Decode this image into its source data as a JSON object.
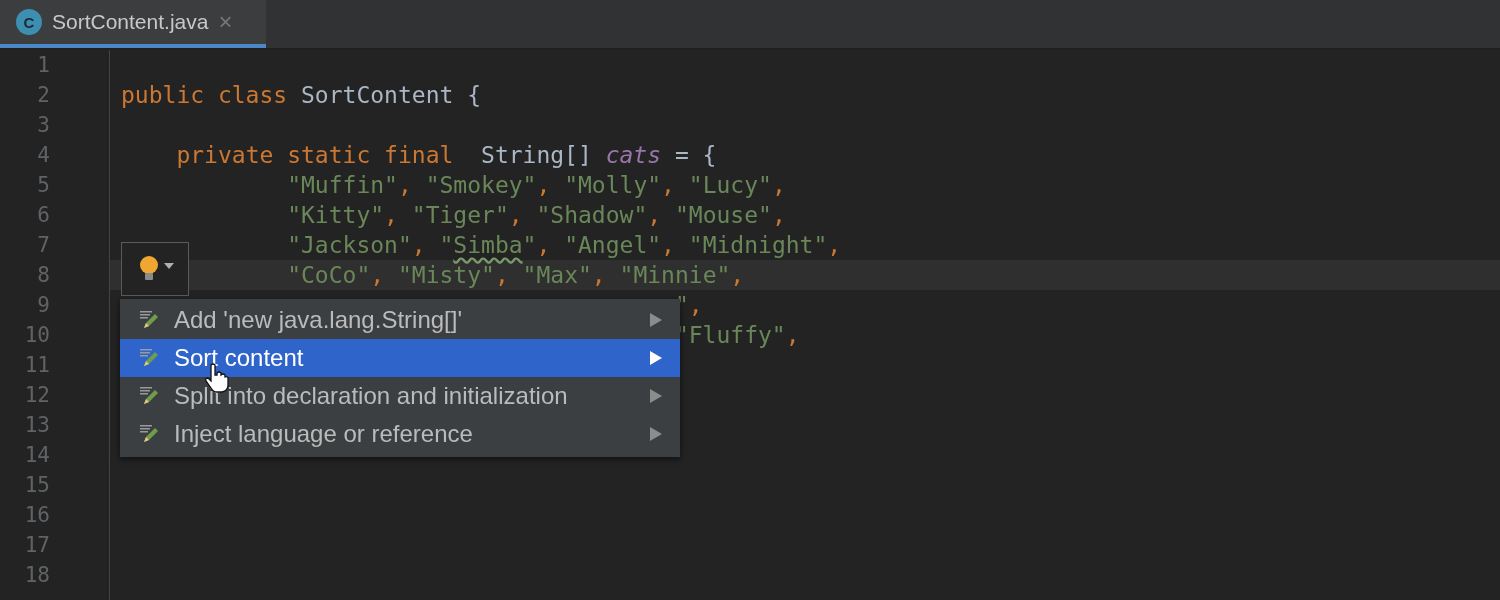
{
  "tabs": [
    {
      "label": "SortContent.java",
      "icon": "C",
      "close": "×",
      "selected": true
    }
  ],
  "lines": [
    {
      "number": "1",
      "current": false
    },
    {
      "number": "2",
      "current": false,
      "segments": [
        {
          "text": "public class ",
          "kind": "keyword"
        },
        {
          "text": "SortContent {",
          "kind": "plain"
        }
      ]
    },
    {
      "number": "3",
      "current": false
    },
    {
      "number": "4",
      "current": false,
      "segments": [
        {
          "text": "    private static final  ",
          "kind": "keyword"
        },
        {
          "text": "String[] ",
          "kind": "plain"
        },
        {
          "text": "cats",
          "kind": "field"
        },
        {
          "text": " = {",
          "kind": "plain"
        }
      ]
    },
    {
      "number": "5",
      "current": false,
      "segments": [
        {
          "text": "            \"Muffin\"",
          "kind": "string"
        },
        {
          "text": ", ",
          "kind": "keyword"
        },
        {
          "text": "\"Smokey\"",
          "kind": "string"
        },
        {
          "text": ", ",
          "kind": "keyword"
        },
        {
          "text": "\"Molly\"",
          "kind": "string"
        },
        {
          "text": ", ",
          "kind": "keyword"
        },
        {
          "text": "\"Lucy\"",
          "kind": "string"
        },
        {
          "text": ",",
          "kind": "keyword"
        }
      ]
    },
    {
      "number": "6",
      "current": false,
      "segments": [
        {
          "text": "            \"Kitty\"",
          "kind": "string"
        },
        {
          "text": ", ",
          "kind": "keyword"
        },
        {
          "text": "\"Tiger\"",
          "kind": "string"
        },
        {
          "text": ", ",
          "kind": "keyword"
        },
        {
          "text": "\"Shadow\"",
          "kind": "string"
        },
        {
          "text": ", ",
          "kind": "keyword"
        },
        {
          "text": "\"Mouse\"",
          "kind": "string"
        },
        {
          "text": ",",
          "kind": "keyword"
        }
      ]
    },
    {
      "number": "7",
      "current": false,
      "segments": [
        {
          "text": "            \"Jackson\"",
          "kind": "string"
        },
        {
          "text": ", ",
          "kind": "keyword"
        },
        {
          "text": "\"",
          "kind": "string"
        },
        {
          "text": "Simba",
          "kind": "string",
          "misspelled": true
        },
        {
          "text": "\"",
          "kind": "string"
        },
        {
          "text": ", ",
          "kind": "keyword"
        },
        {
          "text": "\"Angel\"",
          "kind": "string"
        },
        {
          "text": ", ",
          "kind": "keyword"
        },
        {
          "text": "\"Midnight\"",
          "kind": "string"
        },
        {
          "text": ",",
          "kind": "keyword"
        }
      ]
    },
    {
      "number": "8",
      "current": true,
      "segments": [
        {
          "text": "            \"CoCo\"",
          "kind": "string"
        },
        {
          "text": ", ",
          "kind": "keyword"
        },
        {
          "text": "\"Misty\"",
          "kind": "string"
        },
        {
          "text": ", ",
          "kind": "keyword"
        },
        {
          "text": "\"Max\"",
          "kind": "string"
        },
        {
          "text": ", ",
          "kind": "keyword"
        },
        {
          "text": "\"Minnie\"",
          "kind": "string"
        },
        {
          "text": ",",
          "kind": "keyword"
        }
      ]
    },
    {
      "number": "9",
      "current": false,
      "segments": [
        {
          "text": "                                        \"",
          "kind": "string"
        },
        {
          "text": ",",
          "kind": "keyword"
        }
      ]
    },
    {
      "number": "10",
      "current": false,
      "segments": [
        {
          "text": "                                        \"Fluffy\"",
          "kind": "string"
        },
        {
          "text": ",",
          "kind": "keyword"
        }
      ]
    },
    {
      "number": "11",
      "current": false
    },
    {
      "number": "12",
      "current": false
    },
    {
      "number": "13",
      "current": false
    },
    {
      "number": "14",
      "current": false
    },
    {
      "number": "15",
      "current": false
    },
    {
      "number": "16",
      "current": false
    },
    {
      "number": "17",
      "current": false
    },
    {
      "number": "18",
      "current": false
    }
  ],
  "intention_menu": {
    "items": [
      {
        "label": "Add 'new java.lang.String[]'",
        "selected": false
      },
      {
        "label": "Sort content",
        "selected": true
      },
      {
        "label": "Split into declaration and initialization",
        "selected": false
      },
      {
        "label": "Inject language or reference",
        "selected": false
      }
    ]
  }
}
